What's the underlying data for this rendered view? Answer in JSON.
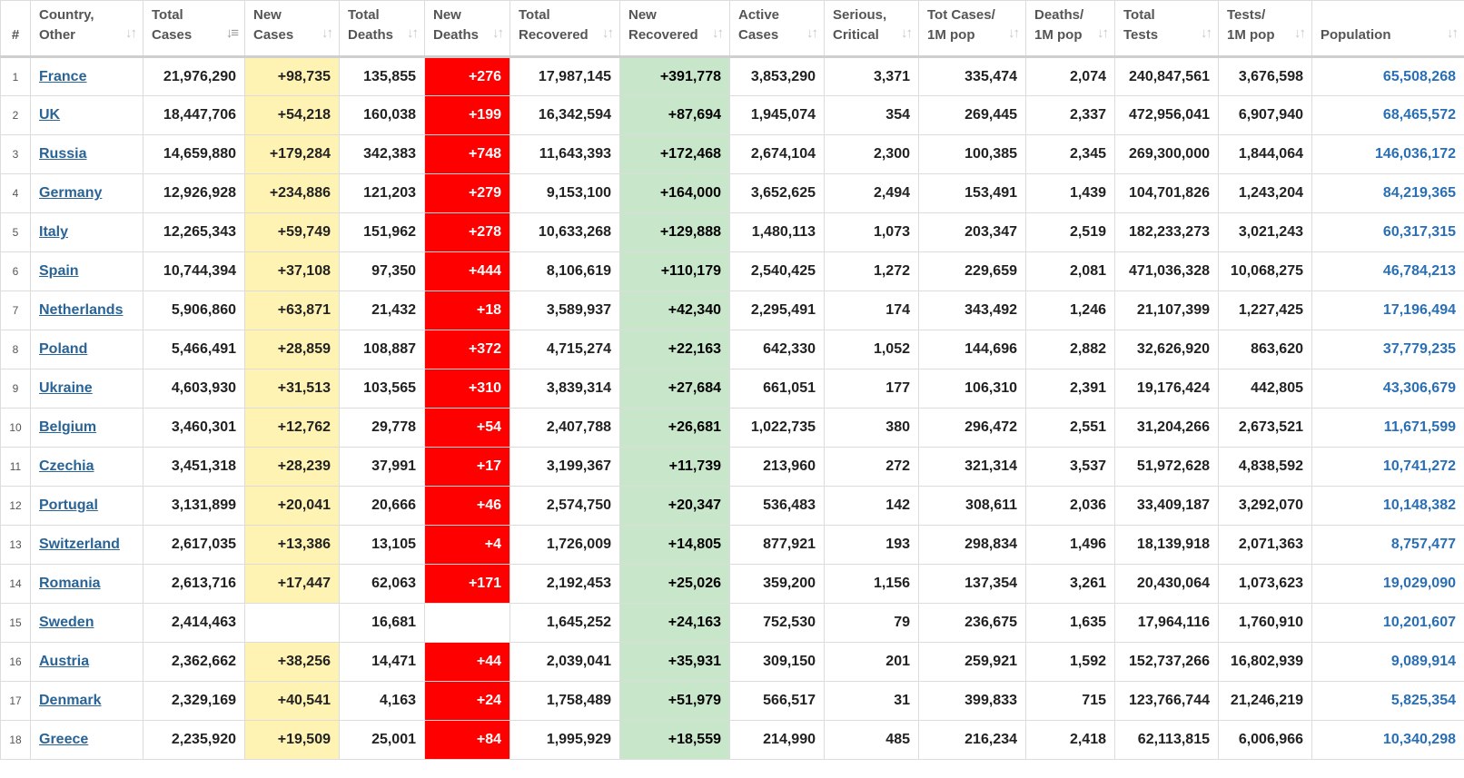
{
  "headers": [
    {
      "key": "rank",
      "label": [
        "#"
      ]
    },
    {
      "key": "country",
      "label": [
        "Country,",
        "Other"
      ]
    },
    {
      "key": "total_cases",
      "label": [
        "Total",
        "Cases"
      ]
    },
    {
      "key": "new_cases",
      "label": [
        "New",
        "Cases"
      ]
    },
    {
      "key": "total_deaths",
      "label": [
        "Total",
        "Deaths"
      ]
    },
    {
      "key": "new_deaths",
      "label": [
        "New",
        "Deaths"
      ]
    },
    {
      "key": "total_recovered",
      "label": [
        "Total",
        "Recovered"
      ]
    },
    {
      "key": "new_recovered",
      "label": [
        "New",
        "Recovered"
      ]
    },
    {
      "key": "active_cases",
      "label": [
        "Active",
        "Cases"
      ]
    },
    {
      "key": "serious_critical",
      "label": [
        "Serious,",
        "Critical"
      ]
    },
    {
      "key": "tot_cases_1m",
      "label": [
        "Tot Cases/",
        "1M pop"
      ]
    },
    {
      "key": "deaths_1m",
      "label": [
        "Deaths/",
        "1M pop"
      ]
    },
    {
      "key": "total_tests",
      "label": [
        "Total",
        "Tests"
      ]
    },
    {
      "key": "tests_1m",
      "label": [
        "Tests/",
        "1M pop"
      ]
    },
    {
      "key": "population",
      "label": [
        "Population"
      ]
    }
  ],
  "sort_icon": "sort-arrows-icon",
  "active_sort_column": "total_cases",
  "colors": {
    "new_cases_bg": "#fff3b4",
    "new_deaths_bg": "#ff0000",
    "new_recovered_bg": "#c8e6c9",
    "link": "#2a6496"
  },
  "rows": [
    [
      "1",
      "France",
      "21,976,290",
      "+98,735",
      "135,855",
      "+276",
      "17,987,145",
      "+391,778",
      "3,853,290",
      "3,371",
      "335,474",
      "2,074",
      "240,847,561",
      "3,676,598",
      "65,508,268"
    ],
    [
      "2",
      "UK",
      "18,447,706",
      "+54,218",
      "160,038",
      "+199",
      "16,342,594",
      "+87,694",
      "1,945,074",
      "354",
      "269,445",
      "2,337",
      "472,956,041",
      "6,907,940",
      "68,465,572"
    ],
    [
      "3",
      "Russia",
      "14,659,880",
      "+179,284",
      "342,383",
      "+748",
      "11,643,393",
      "+172,468",
      "2,674,104",
      "2,300",
      "100,385",
      "2,345",
      "269,300,000",
      "1,844,064",
      "146,036,172"
    ],
    [
      "4",
      "Germany",
      "12,926,928",
      "+234,886",
      "121,203",
      "+279",
      "9,153,100",
      "+164,000",
      "3,652,625",
      "2,494",
      "153,491",
      "1,439",
      "104,701,826",
      "1,243,204",
      "84,219,365"
    ],
    [
      "5",
      "Italy",
      "12,265,343",
      "+59,749",
      "151,962",
      "+278",
      "10,633,268",
      "+129,888",
      "1,480,113",
      "1,073",
      "203,347",
      "2,519",
      "182,233,273",
      "3,021,243",
      "60,317,315"
    ],
    [
      "6",
      "Spain",
      "10,744,394",
      "+37,108",
      "97,350",
      "+444",
      "8,106,619",
      "+110,179",
      "2,540,425",
      "1,272",
      "229,659",
      "2,081",
      "471,036,328",
      "10,068,275",
      "46,784,213"
    ],
    [
      "7",
      "Netherlands",
      "5,906,860",
      "+63,871",
      "21,432",
      "+18",
      "3,589,937",
      "+42,340",
      "2,295,491",
      "174",
      "343,492",
      "1,246",
      "21,107,399",
      "1,227,425",
      "17,196,494"
    ],
    [
      "8",
      "Poland",
      "5,466,491",
      "+28,859",
      "108,887",
      "+372",
      "4,715,274",
      "+22,163",
      "642,330",
      "1,052",
      "144,696",
      "2,882",
      "32,626,920",
      "863,620",
      "37,779,235"
    ],
    [
      "9",
      "Ukraine",
      "4,603,930",
      "+31,513",
      "103,565",
      "+310",
      "3,839,314",
      "+27,684",
      "661,051",
      "177",
      "106,310",
      "2,391",
      "19,176,424",
      "442,805",
      "43,306,679"
    ],
    [
      "10",
      "Belgium",
      "3,460,301",
      "+12,762",
      "29,778",
      "+54",
      "2,407,788",
      "+26,681",
      "1,022,735",
      "380",
      "296,472",
      "2,551",
      "31,204,266",
      "2,673,521",
      "11,671,599"
    ],
    [
      "11",
      "Czechia",
      "3,451,318",
      "+28,239",
      "37,991",
      "+17",
      "3,199,367",
      "+11,739",
      "213,960",
      "272",
      "321,314",
      "3,537",
      "51,972,628",
      "4,838,592",
      "10,741,272"
    ],
    [
      "12",
      "Portugal",
      "3,131,899",
      "+20,041",
      "20,666",
      "+46",
      "2,574,750",
      "+20,347",
      "536,483",
      "142",
      "308,611",
      "2,036",
      "33,409,187",
      "3,292,070",
      "10,148,382"
    ],
    [
      "13",
      "Switzerland",
      "2,617,035",
      "+13,386",
      "13,105",
      "+4",
      "1,726,009",
      "+14,805",
      "877,921",
      "193",
      "298,834",
      "1,496",
      "18,139,918",
      "2,071,363",
      "8,757,477"
    ],
    [
      "14",
      "Romania",
      "2,613,716",
      "+17,447",
      "62,063",
      "+171",
      "2,192,453",
      "+25,026",
      "359,200",
      "1,156",
      "137,354",
      "3,261",
      "20,430,064",
      "1,073,623",
      "19,029,090"
    ],
    [
      "15",
      "Sweden",
      "2,414,463",
      "",
      "16,681",
      "",
      "1,645,252",
      "+24,163",
      "752,530",
      "79",
      "236,675",
      "1,635",
      "17,964,116",
      "1,760,910",
      "10,201,607"
    ],
    [
      "16",
      "Austria",
      "2,362,662",
      "+38,256",
      "14,471",
      "+44",
      "2,039,041",
      "+35,931",
      "309,150",
      "201",
      "259,921",
      "1,592",
      "152,737,266",
      "16,802,939",
      "9,089,914"
    ],
    [
      "17",
      "Denmark",
      "2,329,169",
      "+40,541",
      "4,163",
      "+24",
      "1,758,489",
      "+51,979",
      "566,517",
      "31",
      "399,833",
      "715",
      "123,766,744",
      "21,246,219",
      "5,825,354"
    ],
    [
      "18",
      "Greece",
      "2,235,920",
      "+19,509",
      "25,001",
      "+84",
      "1,995,929",
      "+18,559",
      "214,990",
      "485",
      "216,234",
      "2,418",
      "62,113,815",
      "6,006,966",
      "10,340,298"
    ]
  ]
}
